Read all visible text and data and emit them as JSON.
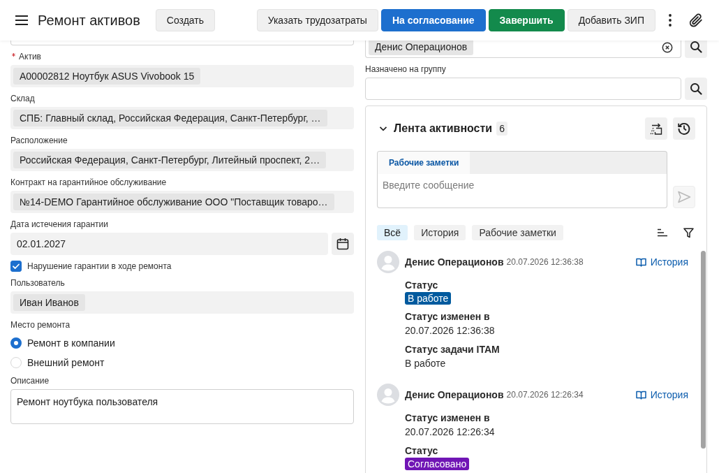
{
  "header": {
    "title": "Ремонт активов",
    "create_button": "Создать",
    "actions": [
      {
        "label": "Указать трудозатраты",
        "kind": "secondary"
      },
      {
        "label": "На согласование",
        "kind": "primary"
      },
      {
        "label": "Завершить",
        "kind": "success"
      },
      {
        "label": "Добавить ЗИП",
        "kind": "secondary"
      }
    ]
  },
  "form": {
    "fields": [
      {
        "kind": "cut_off",
        "readonly": false
      },
      {
        "kind": "chip",
        "label": "Актив",
        "required": true,
        "readonly": true,
        "value": "A00002812 Ноутбук ASUS Vivobook 15"
      },
      {
        "kind": "chip",
        "label": "Склад",
        "required": false,
        "readonly": true,
        "value": "СПБ: Главный склад, Российская Федерация, Санкт-Петербург, …"
      },
      {
        "kind": "chip",
        "label": "Расположение",
        "required": false,
        "readonly": true,
        "value": "Российская Федерация, Санкт-Петербург, Литейный проспект, 2…"
      },
      {
        "kind": "chip",
        "label": "Контракт на гарантийное обслуживание",
        "required": false,
        "readonly": true,
        "value": "№14-DEMO Гарантийное обслуживание ООО \"Поставщик товаро…"
      },
      {
        "kind": "date",
        "label": "Дата истечения гарантии",
        "required": false,
        "readonly": true,
        "value": "02.01.2027"
      },
      {
        "kind": "checkbox",
        "label": "Нарушение гарантии в ходе ремонта",
        "checked": true
      },
      {
        "kind": "chip",
        "label": "Пользователь",
        "required": false,
        "readonly": true,
        "value": "Иван Иванов"
      },
      {
        "kind": "radio",
        "label": "Место ремонта",
        "required": false,
        "options": [
          {
            "label": "Ремонт в компании",
            "selected": true
          },
          {
            "label": "Внешний ремонт",
            "selected": false
          }
        ]
      },
      {
        "kind": "textarea",
        "label": "Описание",
        "required": false,
        "readonly": false,
        "value": "Ремонт ноутбука пользователя"
      }
    ]
  },
  "side": {
    "fields": [
      {
        "kind": "chip_lookup",
        "readonly": false,
        "value": "Денис Операционов"
      },
      {
        "kind": "lookup",
        "label": "Назначено на группу",
        "readonly": false
      }
    ]
  },
  "activity": {
    "title": "Лента активности",
    "count": "6",
    "expanded": true,
    "compose": {
      "tabs": [
        {
          "label": "Рабочие заметки",
          "selected": true
        }
      ],
      "placeholder": "Введите сообщение"
    },
    "send": {
      "disabled": true
    },
    "filters": [
      {
        "label": "Всё",
        "selected": true
      },
      {
        "label": "История",
        "selected": false
      },
      {
        "label": "Рабочие заметки",
        "selected": false
      }
    ],
    "entries": [
      {
        "author": "Денис Операционов",
        "time": "20.07.2026 12:36:38",
        "link": "История",
        "fields": [
          {
            "kind": "badge",
            "label": "Статус",
            "value": "В работе",
            "color": "#005a9e"
          },
          {
            "kind": "text",
            "label": "Статус изменен в",
            "value": "20.07.2026 12:36:38"
          },
          {
            "kind": "text",
            "label": "Статус задачи ITAM",
            "value": "В работе"
          }
        ]
      },
      {
        "author": "Денис Операционов",
        "time": "20.07.2026 12:26:34",
        "link": "История",
        "fields": [
          {
            "kind": "text",
            "label": "Статус изменен в",
            "value": "20.07.2026 12:26:34"
          },
          {
            "kind": "badge",
            "label": "Статус",
            "value": "Согласовано",
            "color": "#7015b5"
          }
        ]
      }
    ]
  }
}
